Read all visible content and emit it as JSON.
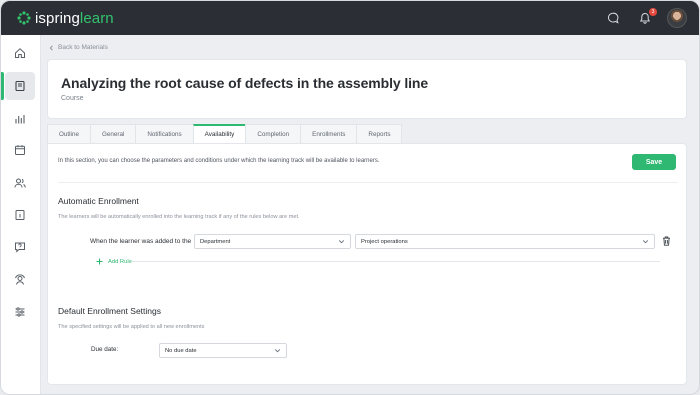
{
  "app": {
    "logo_main": "ispring",
    "logo_accent": "learn",
    "notification_count": "3"
  },
  "breadcrumb": {
    "back_label": "Back to Materials"
  },
  "header": {
    "title": "Analyzing the root cause of defects in the assembly line",
    "type": "Course"
  },
  "tabs": [
    {
      "label": "Outline"
    },
    {
      "label": "General"
    },
    {
      "label": "Notifications"
    },
    {
      "label": "Availability"
    },
    {
      "label": "Completion"
    },
    {
      "label": "Enrollments"
    },
    {
      "label": "Reports"
    }
  ],
  "availability": {
    "intro": "In this section, you can choose the parameters and conditions under which the learning track will be available to learners.",
    "save_label": "Save",
    "auto_title": "Automatic Enrollment",
    "auto_desc": "The learners will be automatically enrolled into the learning track if any of the rules below are met.",
    "rule_label": "When the learner was added to the",
    "rule_field_value": "Department",
    "rule_target_value": "Project operations",
    "add_rule_label": "Add Rule",
    "default_title": "Default Enrollment Settings",
    "default_desc": "The specified settings will be applied to all new enrollments",
    "due_label": "Due date:",
    "due_value": "No due date"
  },
  "colors": {
    "accent": "#2eb872",
    "topbar": "#2b2f35",
    "badge": "#e5483d"
  },
  "icons": [
    "home-icon",
    "book-icon",
    "bar-chart-icon",
    "calendar-icon",
    "users-icon",
    "info-book-icon",
    "help-icon",
    "coaching-icon",
    "sliders-icon",
    "chat-icon",
    "bell-icon"
  ]
}
